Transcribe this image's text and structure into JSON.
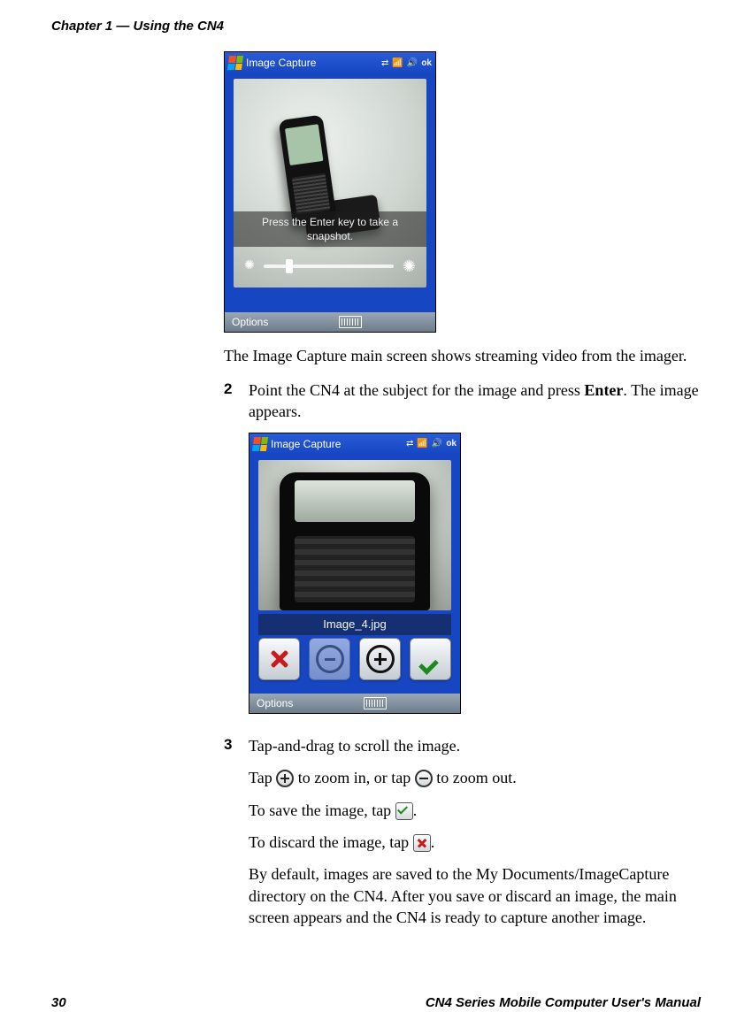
{
  "header": {
    "chapter_title": "Chapter 1 — Using the CN4"
  },
  "footer": {
    "page_number": "30",
    "manual_title": "CN4 Series Mobile Computer User's Manual"
  },
  "screenshot1": {
    "title": "Image Capture",
    "ok_label": "ok",
    "hint": "Press the Enter key to take a snapshot.",
    "menu_left": "Options"
  },
  "caption1": "The Image Capture main screen shows streaming video from the imager.",
  "step2": {
    "num": "2",
    "text_a": "Point the CN4 at the subject for the image and press ",
    "bold": "Enter",
    "text_b": ". The image appears."
  },
  "screenshot2": {
    "title": "Image Capture",
    "ok_label": "ok",
    "filename": "Image_4.jpg",
    "menu_left": "Options"
  },
  "step3": {
    "num": "3",
    "line1": "Tap-and-drag to scroll the image.",
    "line2_a": "Tap ",
    "line2_b": " to zoom in, or tap ",
    "line2_c": " to zoom out.",
    "line3_a": "To save the image, tap ",
    "line3_b": ".",
    "line4_a": "To discard the image, tap ",
    "line4_b": ".",
    "line5": "By default, images are saved to the My Documents/ImageCapture directory on the CN4. After you save or discard an image, the main screen appears and the CN4 is ready to capture another image."
  }
}
